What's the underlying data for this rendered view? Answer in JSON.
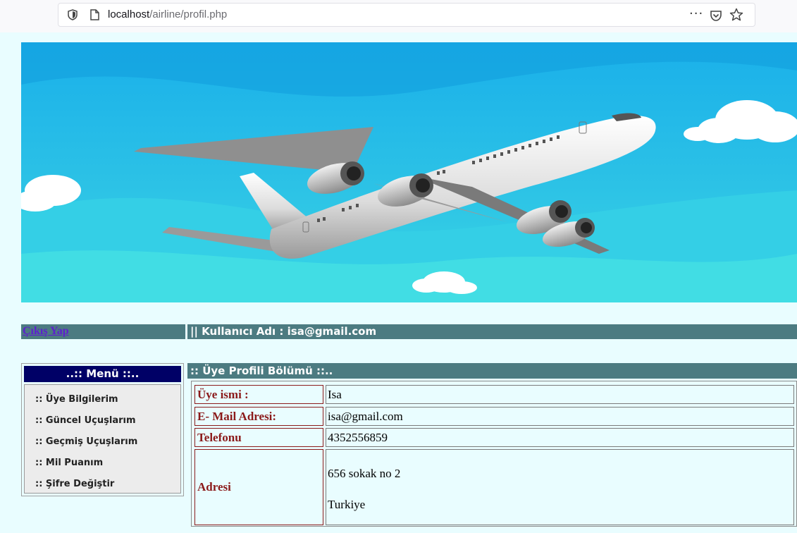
{
  "browser": {
    "url_host": "localhost",
    "url_path": "/airline/profil.php",
    "more_label": "···"
  },
  "banner": {
    "icon": "airplane-illustration",
    "colors": {
      "sky": "#1ab0ea",
      "cloud": "#ffffff"
    }
  },
  "topbar": {
    "logout_label": "Çıkış Yap",
    "user_label": "|| Kullanıcı Adı : isa@gmail.com"
  },
  "menu": {
    "title": "..:: Menü ::..",
    "items": [
      {
        "label": ":: Üye Bilgilerim"
      },
      {
        "label": ":: Güncel Uçuşlarım"
      },
      {
        "label": ":: Geçmiş Uçuşlarım"
      },
      {
        "label": ":: Mil Puanım"
      },
      {
        "label": ":: Şifre Değiştir"
      }
    ]
  },
  "profile": {
    "header": ":: Üye Profili Bölümü ::..",
    "rows": [
      {
        "label": "Üye ismi :",
        "value": "Isa"
      },
      {
        "label": "E- Mail Adresi:",
        "value": "isa@gmail.com"
      },
      {
        "label": "Telefonu",
        "value": "4352556859"
      },
      {
        "label": "Adresi",
        "value_line1": "656 sokak no 2",
        "value_line2": "Turkiye"
      }
    ]
  },
  "colors": {
    "page_bg": "#e9fdff",
    "bar_bg": "#4c7b81",
    "menu_title_bg": "#000066",
    "label_color": "#8b1a1a",
    "link_color": "#5d1fcf"
  }
}
